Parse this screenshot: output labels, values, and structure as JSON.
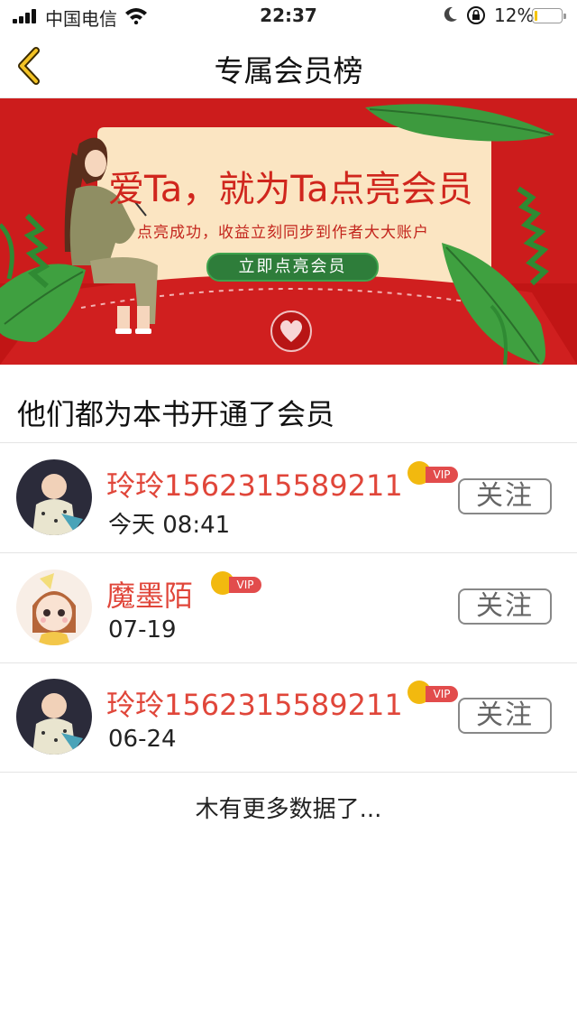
{
  "status_bar": {
    "carrier": "中国电信",
    "time": "22:37",
    "battery_percent": "12%",
    "battery_level": 0.12
  },
  "nav": {
    "title": "专属会员榜"
  },
  "banner": {
    "headline": "爱Ta，就为Ta点亮会员",
    "subtitle": "点亮成功，收益立刻同步到作者大大账户",
    "cta_label": "立即点亮会员"
  },
  "section": {
    "title": "他们都为本书开通了会员"
  },
  "members": [
    {
      "name": "玲玲1562315589211",
      "vip_label": "VIP",
      "date": "今天 08:41",
      "follow_label": "关注"
    },
    {
      "name": "魔墨陌",
      "vip_label": "VIP",
      "date": "07-19",
      "follow_label": "关注"
    },
    {
      "name": "玲玲1562315589211",
      "vip_label": "VIP",
      "date": "06-24",
      "follow_label": "关注"
    }
  ],
  "footer": {
    "no_more_text": "木有更多数据了..."
  },
  "colors": {
    "accent_red": "#e0463a",
    "banner_red": "#cf1b1b",
    "cta_green": "#2e7d3a",
    "vip_gold": "#f2b90f"
  }
}
